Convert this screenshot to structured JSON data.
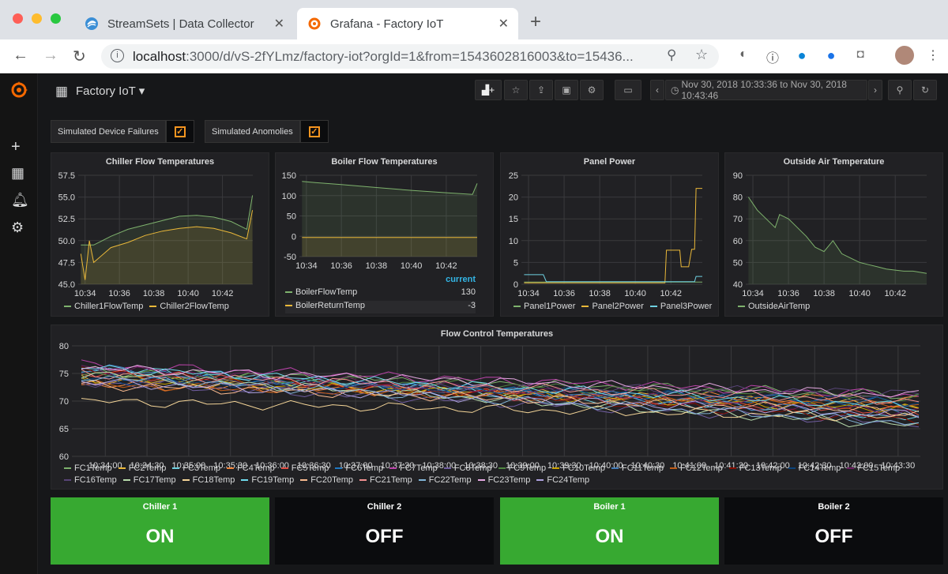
{
  "browser": {
    "tabs": [
      {
        "title": "StreamSets | Data Collector",
        "icon": "streamsets-icon",
        "active": false
      },
      {
        "title": "Grafana - Factory IoT",
        "icon": "grafana-icon",
        "active": true
      }
    ],
    "url_host": "localhost",
    "url_rest": ":3000/d/vS-2fYLmz/factory-iot?orgId=1&from=1543602816003&to=15436..."
  },
  "dashboard": {
    "title": "Factory IoT ▾",
    "time_range": "Nov 30, 2018 10:33:36 to Nov 30, 2018 10:43:46",
    "variables": [
      {
        "label": "Simulated Device Failures",
        "checked": true
      },
      {
        "label": "Simulated Anomolies",
        "checked": true
      }
    ]
  },
  "colors": {
    "green": "#7eb26d",
    "yellow": "#eab839",
    "blue": "#6ed0e0",
    "orange": "#ef843c",
    "red": "#e24d42",
    "darkblue": "#1f78c1",
    "purple": "#ba43a9",
    "violet": "#705da0",
    "darkgreen": "#508642",
    "stat_green": "#37a931"
  },
  "panels": {
    "chiller": {
      "title": "Chiller Flow Temperatures"
    },
    "boiler": {
      "title": "Boiler Flow Temperatures",
      "legend_header": "current",
      "rows": [
        {
          "name": "BoilerFlowTemp",
          "value": "130"
        },
        {
          "name": "BoilerReturnTemp",
          "value": "-3"
        }
      ]
    },
    "panel_power": {
      "title": "Panel Power"
    },
    "outside_air": {
      "title": "Outside Air Temperature"
    },
    "flow_control": {
      "title": "Flow Control Temperatures"
    }
  },
  "stats": [
    {
      "title": "Chiller 1",
      "value": "ON",
      "state": "on"
    },
    {
      "title": "Chiller 2",
      "value": "OFF",
      "state": "off"
    },
    {
      "title": "Boiler 1",
      "value": "ON",
      "state": "on"
    },
    {
      "title": "Boiler 2",
      "value": "OFF",
      "state": "off"
    }
  ],
  "chart_data": [
    {
      "type": "line",
      "title": "Chiller Flow Temperatures",
      "categories": [
        "10:34",
        "10:36",
        "10:38",
        "10:40",
        "10:42"
      ],
      "ylim": [
        45,
        57.5
      ],
      "yticks": [
        "57.5",
        "55.0",
        "52.5",
        "50.0",
        "47.5",
        "45.0"
      ],
      "series": [
        {
          "name": "Chiller1FlowTemp",
          "x": [
            "10:33:45",
            "10:34:30",
            "10:35:30",
            "10:36:30",
            "10:37:30",
            "10:38:30",
            "10:39:30",
            "10:40:30",
            "10:41:30",
            "10:42:30",
            "10:43:25",
            "10:43:45"
          ],
          "values": [
            49.5,
            49.5,
            50.5,
            51.3,
            51.8,
            52.3,
            52.8,
            52.9,
            52.7,
            52.2,
            51.3,
            55.2
          ]
        },
        {
          "name": "Chiller2FlowTemp",
          "x": [
            "10:33:45",
            "10:34:00",
            "10:34:15",
            "10:34:30",
            "10:35:30",
            "10:36:30",
            "10:37:30",
            "10:38:30",
            "10:39:30",
            "10:40:30",
            "10:41:30",
            "10:42:30",
            "10:43:25",
            "10:43:45"
          ],
          "values": [
            48.5,
            45.5,
            50.0,
            47.5,
            49.2,
            49.8,
            50.6,
            51.1,
            51.4,
            51.6,
            51.4,
            50.9,
            50.2,
            53.5
          ]
        }
      ]
    },
    {
      "type": "line",
      "title": "Boiler Flow Temperatures",
      "categories": [
        "10:34",
        "10:36",
        "10:38",
        "10:40",
        "10:42"
      ],
      "ylim": [
        -50,
        150
      ],
      "yticks": [
        "150",
        "100",
        "50",
        "0",
        "-50"
      ],
      "series": [
        {
          "name": "BoilerFlowTemp",
          "x": [
            "10:33:45",
            "10:34:30",
            "10:36:00",
            "10:38:00",
            "10:40:00",
            "10:42:00",
            "10:43:30",
            "10:43:46"
          ],
          "values": [
            135,
            132,
            127,
            120,
            113,
            107,
            103,
            130
          ]
        },
        {
          "name": "BoilerReturnTemp",
          "x": [
            "10:33:45",
            "10:43:46"
          ],
          "values": [
            -3,
            -3
          ]
        }
      ]
    },
    {
      "type": "line",
      "title": "Panel Power",
      "categories": [
        "10:34",
        "10:36",
        "10:38",
        "10:40",
        "10:42"
      ],
      "ylim": [
        0,
        25
      ],
      "yticks": [
        "25",
        "20",
        "15",
        "10",
        "5",
        "0"
      ],
      "series": [
        {
          "name": "Panel1Power",
          "x": [
            "10:33:45",
            "10:43:20",
            "10:43:46"
          ],
          "values": [
            0.5,
            0.5,
            0.5
          ]
        },
        {
          "name": "Panel2Power",
          "x": [
            "10:33:45",
            "10:34:00",
            "10:41:40",
            "10:41:45",
            "10:42:30",
            "10:42:35",
            "10:43:00",
            "10:43:10",
            "10:43:20",
            "10:43:25",
            "10:43:46"
          ],
          "values": [
            0.3,
            0.3,
            0.3,
            7.8,
            7.8,
            4.0,
            4.0,
            8.0,
            8.0,
            22.0,
            22.0
          ]
        },
        {
          "name": "Panel3Power",
          "x": [
            "10:33:45",
            "10:34:50",
            "10:35:00",
            "10:43:20",
            "10:43:25",
            "10:43:46"
          ],
          "values": [
            2.2,
            2.2,
            0.6,
            0.6,
            1.8,
            1.8
          ]
        }
      ]
    },
    {
      "type": "line",
      "title": "Outside Air Temperature",
      "categories": [
        "10:34",
        "10:36",
        "10:38",
        "10:40",
        "10:42"
      ],
      "ylim": [
        40,
        90
      ],
      "yticks": [
        "90",
        "80",
        "70",
        "60",
        "50",
        "40"
      ],
      "series": [
        {
          "name": "OutsideAirTemp",
          "x": [
            "10:33:45",
            "10:34:15",
            "10:34:45",
            "10:35:15",
            "10:35:30",
            "10:36:00",
            "10:36:30",
            "10:37:00",
            "10:37:30",
            "10:38:00",
            "10:38:30",
            "10:39:00",
            "10:39:30",
            "10:40:00",
            "10:40:30",
            "10:41:00",
            "10:41:30",
            "10:42:00",
            "10:42:30",
            "10:43:00",
            "10:43:46"
          ],
          "values": [
            80,
            74,
            70,
            66,
            72,
            70,
            66,
            62,
            57,
            55,
            60,
            54,
            52,
            50,
            49,
            48,
            47,
            46.5,
            46,
            46,
            45
          ]
        }
      ]
    },
    {
      "type": "line",
      "title": "Flow Control Temperatures",
      "categories": [
        "10:34:00",
        "10:34:30",
        "10:35:00",
        "10:35:30",
        "10:36:00",
        "10:36:30",
        "10:37:00",
        "10:37:30",
        "10:38:00",
        "10:38:30",
        "10:39:00",
        "10:39:30",
        "10:40:00",
        "10:40:30",
        "10:41:00",
        "10:41:30",
        "10:42:00",
        "10:42:30",
        "10:43:00",
        "10:43:30"
      ],
      "ylim": [
        60,
        80
      ],
      "yticks": [
        "80",
        "75",
        "70",
        "65",
        "60"
      ],
      "series": [
        {
          "name": "FC1Temp",
          "start": 75.5,
          "end": 71
        },
        {
          "name": "FC2Temp",
          "start": 74,
          "end": 69
        },
        {
          "name": "FC3Temp",
          "start": 76,
          "end": 67
        },
        {
          "name": "FC4Temp",
          "start": 73,
          "end": 70
        },
        {
          "name": "FC5Temp",
          "start": 75,
          "end": 68
        },
        {
          "name": "FC6Temp",
          "start": 74.5,
          "end": 69.5
        },
        {
          "name": "FC7Temp",
          "start": 76.5,
          "end": 71
        },
        {
          "name": "FC8Temp",
          "start": 73.5,
          "end": 66
        },
        {
          "name": "FC9Temp",
          "start": 75,
          "end": 70.5
        },
        {
          "name": "FC10Temp",
          "start": 74,
          "end": 68.5
        },
        {
          "name": "FC11Temp",
          "start": 76,
          "end": 67.5
        },
        {
          "name": "FC12Temp",
          "start": 73,
          "end": 69
        },
        {
          "name": "FC13Temp",
          "start": 75.5,
          "end": 66.5
        },
        {
          "name": "FC14Temp",
          "start": 74,
          "end": 70
        },
        {
          "name": "FC15Temp",
          "start": 76,
          "end": 68
        },
        {
          "name": "FC16Temp",
          "start": 73.5,
          "end": 71.5
        },
        {
          "name": "FC17Temp",
          "start": 75,
          "end": 65.5
        },
        {
          "name": "FC18Temp",
          "start": 70,
          "end": 67
        },
        {
          "name": "FC19Temp",
          "start": 76,
          "end": 69
        },
        {
          "name": "FC20Temp",
          "start": 73,
          "end": 68
        },
        {
          "name": "FC21Temp",
          "start": 75,
          "end": 70
        },
        {
          "name": "FC22Temp",
          "start": 74.5,
          "end": 66
        },
        {
          "name": "FC23Temp",
          "start": 76,
          "end": 71
        },
        {
          "name": "FC24Temp",
          "start": 73.5,
          "end": 67.5
        }
      ]
    }
  ]
}
